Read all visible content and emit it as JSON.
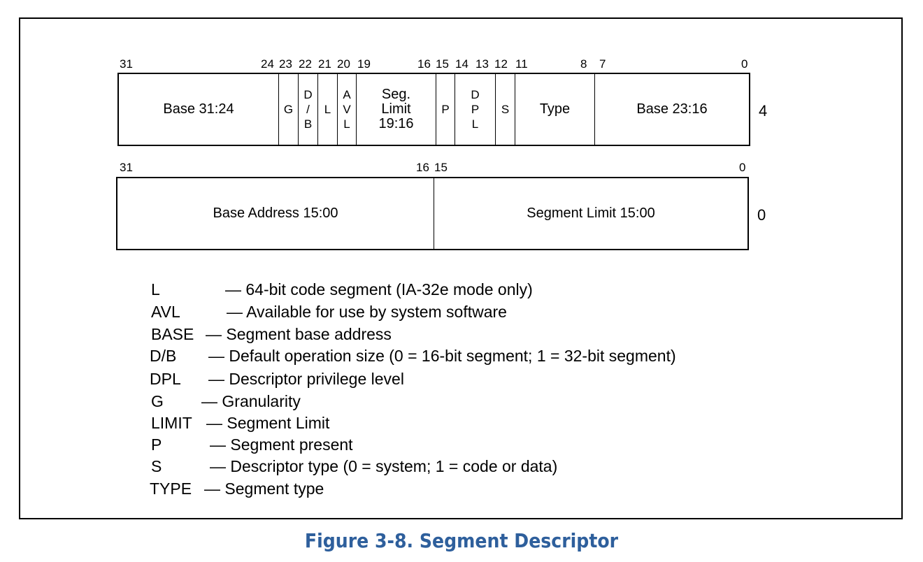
{
  "figure": {
    "caption": "Figure 3-8.  Segment Descriptor",
    "caption_color": "#2e5f9c"
  },
  "upper_word": {
    "offset_label": "4",
    "bit_labels": [
      "31",
      "24",
      "23",
      "22",
      "21",
      "20",
      "19",
      "16",
      "15",
      "14",
      "13",
      "12",
      "11",
      "8",
      "7",
      "0"
    ],
    "fields": [
      {
        "id": "base-31-24",
        "lines": [
          "Base 31:24"
        ],
        "bits": "31:24"
      },
      {
        "id": "g",
        "lines": [
          "G"
        ],
        "bits": "23"
      },
      {
        "id": "d-b",
        "lines": [
          "D",
          "/",
          "B"
        ],
        "bits": "22"
      },
      {
        "id": "l",
        "lines": [
          "L"
        ],
        "bits": "21"
      },
      {
        "id": "avl",
        "lines": [
          "A",
          "V",
          "L"
        ],
        "bits": "20"
      },
      {
        "id": "seg-limit-19-16",
        "lines": [
          "Seg.",
          "Limit",
          "19:16"
        ],
        "bits": "19:16"
      },
      {
        "id": "p",
        "lines": [
          "P"
        ],
        "bits": "15"
      },
      {
        "id": "dpl",
        "lines": [
          "D",
          "P",
          "L"
        ],
        "bits": "14:13"
      },
      {
        "id": "s",
        "lines": [
          "S"
        ],
        "bits": "12"
      },
      {
        "id": "type",
        "lines": [
          "Type"
        ],
        "bits": "11:8"
      },
      {
        "id": "base-23-16",
        "lines": [
          "Base 23:16"
        ],
        "bits": "7:0"
      }
    ]
  },
  "lower_word": {
    "offset_label": "0",
    "bit_labels": [
      "31",
      "16",
      "15",
      "0"
    ],
    "fields": [
      {
        "id": "base-address-15-00",
        "label": "Base Address 15:00",
        "bits": "31:16"
      },
      {
        "id": "segment-limit-15-00",
        "label": "Segment Limit 15:00",
        "bits": "15:0"
      }
    ]
  },
  "legend": [
    {
      "key": "L",
      "desc": "— 64-bit code segment (IA-32e mode only)"
    },
    {
      "key": "AVL",
      "desc": "— Available for use by system software"
    },
    {
      "key": "BASE",
      "desc": "— Segment base address"
    },
    {
      "key": "D/B",
      "desc": "— Default operation size (0 = 16-bit segment; 1 = 32-bit segment)"
    },
    {
      "key": "DPL",
      "desc": "— Descriptor privilege level"
    },
    {
      "key": "G",
      "desc": "— Granularity"
    },
    {
      "key": "LIMIT",
      "desc": "— Segment Limit"
    },
    {
      "key": "P",
      "desc": "— Segment present"
    },
    {
      "key": "S",
      "desc": "— Descriptor type (0 = system; 1 = code or data)"
    },
    {
      "key": "TYPE",
      "desc": "— Segment type"
    }
  ]
}
